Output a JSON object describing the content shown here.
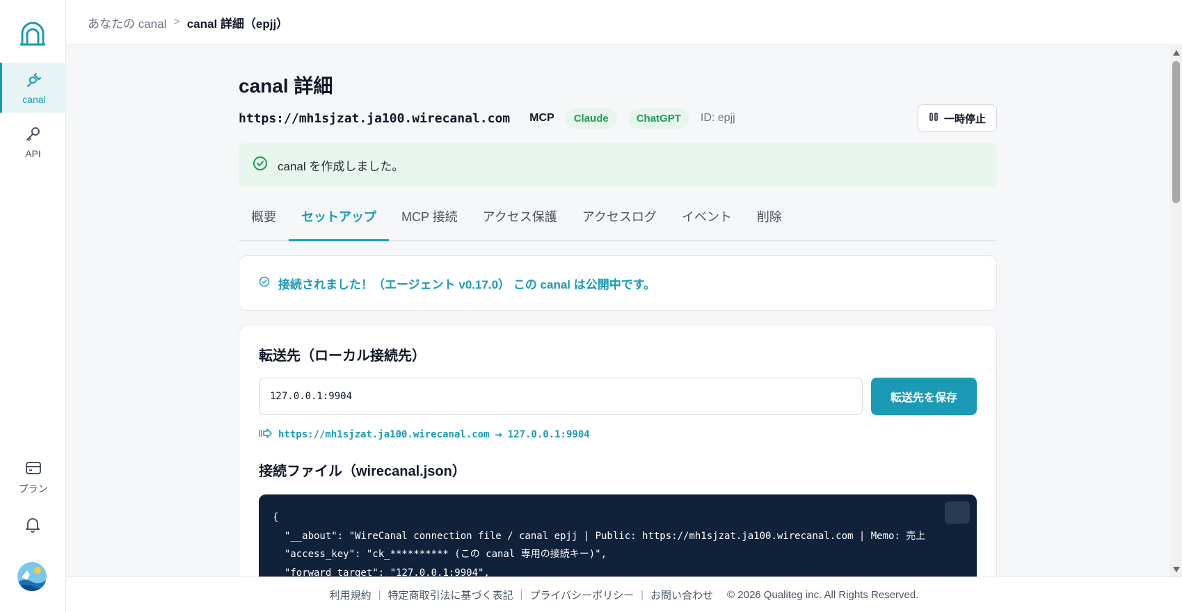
{
  "sidebar": {
    "items": [
      {
        "label": "canal",
        "icon": "plug-icon",
        "active": true
      },
      {
        "label": "API",
        "icon": "key-icon",
        "active": false
      }
    ],
    "plan_label": "プラン"
  },
  "breadcrumb": {
    "parent": "あなたの canal",
    "separator": ">",
    "current": "canal 詳細（epjj）"
  },
  "page": {
    "title": "canal 詳細",
    "url": "https://mh1sjzat.ja100.wirecanal.com",
    "mcp_tag": "MCP",
    "badges": [
      "Claude",
      "ChatGPT"
    ],
    "id_text": "ID: epjj",
    "pause_label": "一時停止"
  },
  "alert": {
    "message": "canal を作成しました。"
  },
  "tabs": [
    {
      "label": "概要",
      "active": false
    },
    {
      "label": "セットアップ",
      "active": true
    },
    {
      "label": "MCP 接続",
      "active": false
    },
    {
      "label": "アクセス保護",
      "active": false
    },
    {
      "label": "アクセスログ",
      "active": false
    },
    {
      "label": "イベント",
      "active": false
    },
    {
      "label": "削除",
      "active": false
    }
  ],
  "status": {
    "message": "接続されました！（エージェント v0.17.0） この canal は公開中です。"
  },
  "forward": {
    "title": "転送先（ローカル接続先）",
    "value": "127.0.0.1:9904",
    "save_label": "転送先を保存",
    "route_from": "https://mh1sjzat.ja100.wirecanal.com",
    "route_arrow": "→",
    "route_to": "127.0.0.1:9904"
  },
  "connection_file": {
    "title": "接続ファイル（wirecanal.json）",
    "lines": [
      "{",
      "  \"__about\": \"WireCanal connection file / canal epjj | Public: https://mh1sjzat.ja100.wirecanal.com | Memo: 売上",
      "  \"access_key\": \"ck_********** (この canal 専用の接続キー)\",",
      "  \"forward_target\": \"127.0.0.1:9904\","
    ]
  },
  "footer": {
    "links": [
      "利用規約",
      "特定商取引法に基づく表記",
      "プライバシーポリシー",
      "お問い合わせ"
    ],
    "copyright": "© 2026 Qualiteg inc. All Rights Reserved."
  },
  "colors": {
    "accent": "#1a9ab5",
    "success_bg": "#e8f5ec",
    "badge_text": "#1f9d55",
    "code_bg": "#10213a"
  }
}
